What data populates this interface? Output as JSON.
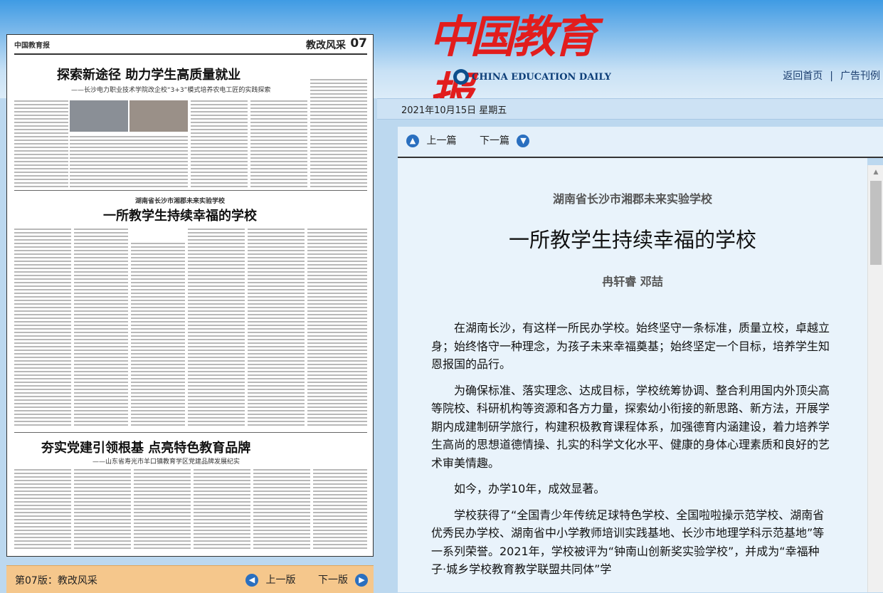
{
  "header": {
    "logo_cn": "中国教育报",
    "logo_en": "CHINA EDUCATION DAILY",
    "links": [
      "返回首页",
      "广告刊例"
    ],
    "link_separator": "|"
  },
  "date": "2021年10月15日 星期五",
  "newspaper": {
    "masthead": "中国教育报",
    "section": "教改风采",
    "page_number": "07",
    "headline_1": "探索新途径 助力学生高质量就业",
    "subhead_1": "——长沙电力职业技术学院改企校“3+3”模式培养农电工匠的实践探索",
    "kicker_2": "湖南省长沙市湘郡未来实验学校",
    "headline_2": "一所教学生持续幸福的学校",
    "headline_3": "夯实党建引领根基 点亮特色教育品牌",
    "subhead_3": "——山东省寿光市羊口镇教育学区党建品牌发展纪实"
  },
  "left_footer": {
    "page_label": "第07版：教改风采",
    "prev": "上一版",
    "next": "下一版"
  },
  "article_nav": {
    "prev": "上一篇",
    "next": "下一篇"
  },
  "article": {
    "kicker": "湖南省长沙市湘郡未来实验学校",
    "title": "一所教学生持续幸福的学校",
    "authors": "冉轩睿 邓喆",
    "paragraphs": [
      "在湖南长沙，有这样一所民办学校。始终坚守一条标准，质量立校，卓越立身；始终恪守一种理念，为孩子未来幸福奠基；始终坚定一个目标，培养学生知恩报国的品行。",
      "为确保标准、落实理念、达成目标，学校统筹协调、整合利用国内外顶尖高等院校、科研机构等资源和各方力量，探索幼小衔接的新思路、新方法，开展学期内成建制研学旅行，构建积极教育课程体系，加强德育内涵建设，着力培养学生高尚的思想道德情操、扎实的科学文化水平、健康的身体心理素质和良好的艺术审美情趣。",
      "如今，办学10年，成效显著。",
      "学校获得了“全国青少年传统足球特色学校、全国啦啦操示范学校、湖南省优秀民办学校、湖南省中小学教师培训实践基地、长沙市地理学科示范基地”等一系列荣誉。2021年，学校被评为“钟南山创新奖实验学校”，并成为“幸福种子·城乡学校教育教学联盟共同体”学"
    ]
  },
  "colors": {
    "logo_red": "#e21d1d",
    "footer_orange": "#f5c78c",
    "nav_blue": "#2a6fbf"
  }
}
